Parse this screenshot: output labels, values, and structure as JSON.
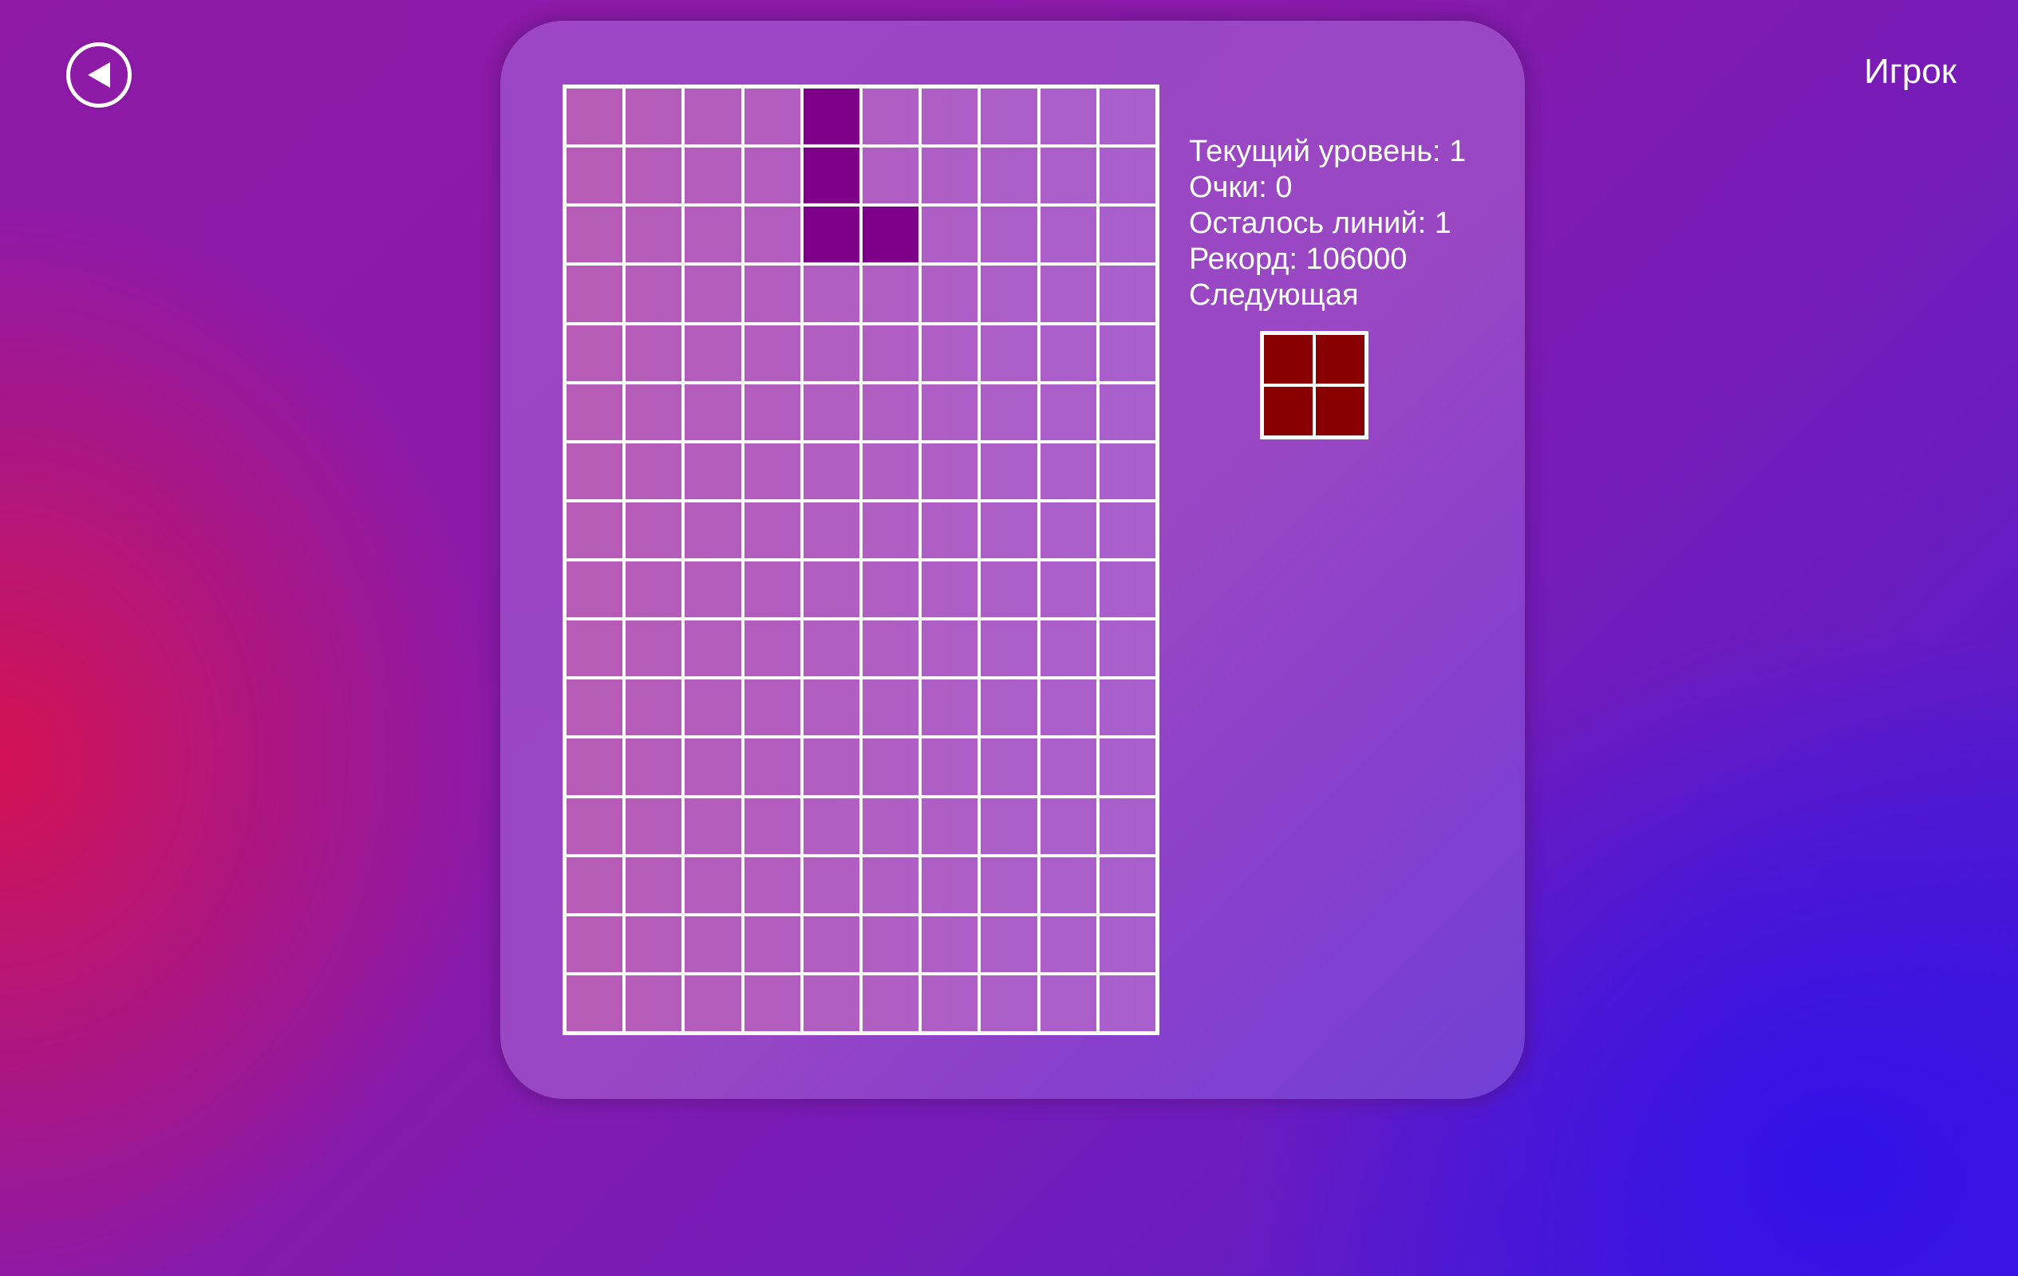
{
  "header": {
    "back_icon": "back-arrow-icon",
    "player_label": "Игрок"
  },
  "stats": {
    "level": "Текущий уровень: 1",
    "score": "Очки: 0",
    "lines_left": "Осталось линий: 1",
    "record": "Рекорд: 106000",
    "next_label": "Следующая"
  },
  "board": {
    "columns": 10,
    "rows": 16,
    "active_piece_color": "#7e0088",
    "filled_cells": [
      {
        "row": 0,
        "col": 4
      },
      {
        "row": 1,
        "col": 4
      },
      {
        "row": 2,
        "col": 4
      },
      {
        "row": 2,
        "col": 5
      }
    ]
  },
  "next_piece": {
    "shape": "O",
    "color": "#880000"
  },
  "colors": {
    "board_cell": "#b060c8",
    "grid_line": "#ffffff",
    "panel": "#9a47c3"
  }
}
